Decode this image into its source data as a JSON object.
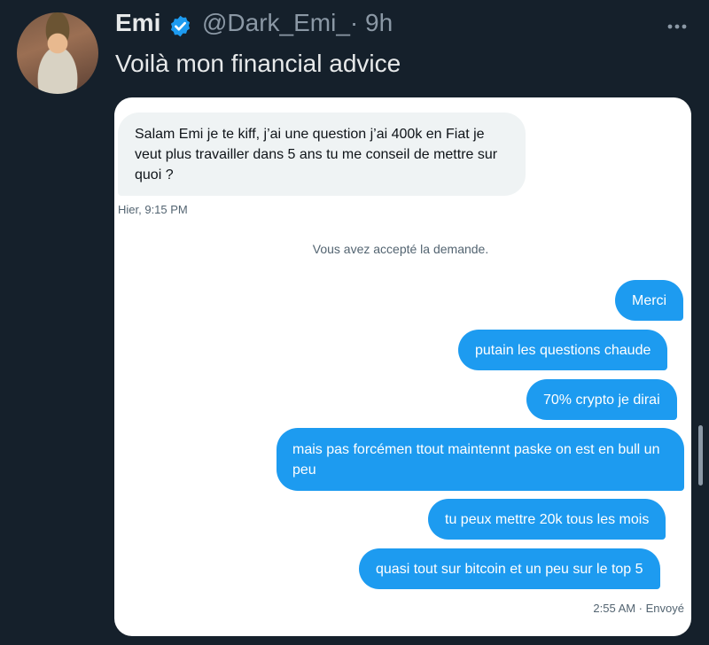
{
  "tweet": {
    "name": "Emi",
    "handle": "@Dark_Emi_",
    "time": "· 9h",
    "text": "Voilà mon financial advice",
    "icons": {
      "verified": "verified-badge-icon",
      "more": "more-options-icon"
    }
  },
  "dm": {
    "incoming": {
      "text": "Salam Emi je te kiff, j’ai une question j’ai 400k en Fiat je veut plus travailler dans 5 ans tu me conseil de mettre sur quoi ?",
      "timestamp": "Hier, 9:15 PM"
    },
    "system_note": "Vous avez accepté la demande.",
    "outgoing": [
      "Merci",
      "putain les questions chaude",
      "70% crypto je dirai",
      "mais pas forcémen ttout maintennt paske on est en bull un peu",
      "tu peux mettre 20k tous les mois",
      "quasi tout sur bitcoin et un peu sur le top 5"
    ],
    "footer": "2:55 AM · Envoyé"
  },
  "colors": {
    "background": "#15202b",
    "bubble_out": "#1d9bf0",
    "bubble_in": "#eff3f4",
    "verified": "#1d9bf0"
  }
}
